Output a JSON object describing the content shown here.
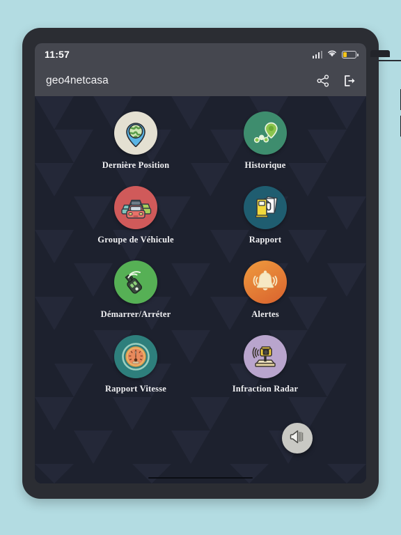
{
  "device": {
    "frame_color": "#2b2d33",
    "background_color": "#b3dce2",
    "screen_background": "#1d212e"
  },
  "status_bar": {
    "time": "11:57",
    "signal_icon": "signal-bars-icon",
    "wifi_icon": "wifi-icon",
    "battery_icon": "battery-low-icon",
    "battery_color": "#f5c518"
  },
  "app_bar": {
    "title": "geo4netcasa",
    "actions": [
      {
        "name": "share-icon",
        "label": "Partager"
      },
      {
        "name": "logout-icon",
        "label": "Déconnexion"
      }
    ]
  },
  "menu": {
    "items": [
      {
        "label": "Dernière Position",
        "icon": "globe-map-pin-icon",
        "circle_color": "#e4e0d2"
      },
      {
        "label": "Historique",
        "icon": "route-path-pin-icon",
        "circle_color": "#3e8d6e"
      },
      {
        "label": "Groupe de Véhicule",
        "icon": "cars-group-icon",
        "circle_color": "#d05a5a"
      },
      {
        "label": "Rapport",
        "icon": "fuel-pump-report-icon",
        "circle_color": "#1f5d70"
      },
      {
        "label": "Démarrer/Arréter",
        "icon": "car-key-remote-icon",
        "circle_color": "#56b055"
      },
      {
        "label": "Alertes",
        "icon": "bell-alert-icon",
        "circle_color": "#e88a33"
      },
      {
        "label": "Rapport Vitesse",
        "icon": "speedometer-icon",
        "circle_color": "#2e7f7c"
      },
      {
        "label": "Infraction Radar",
        "icon": "speed-camera-icon",
        "circle_color": "#b9a5cd"
      }
    ]
  },
  "fab": {
    "icon": "speaker-volume-icon",
    "label": "Son",
    "color": "#c9c9c4"
  },
  "home_indicator": {
    "name": "home-indicator-bar"
  }
}
